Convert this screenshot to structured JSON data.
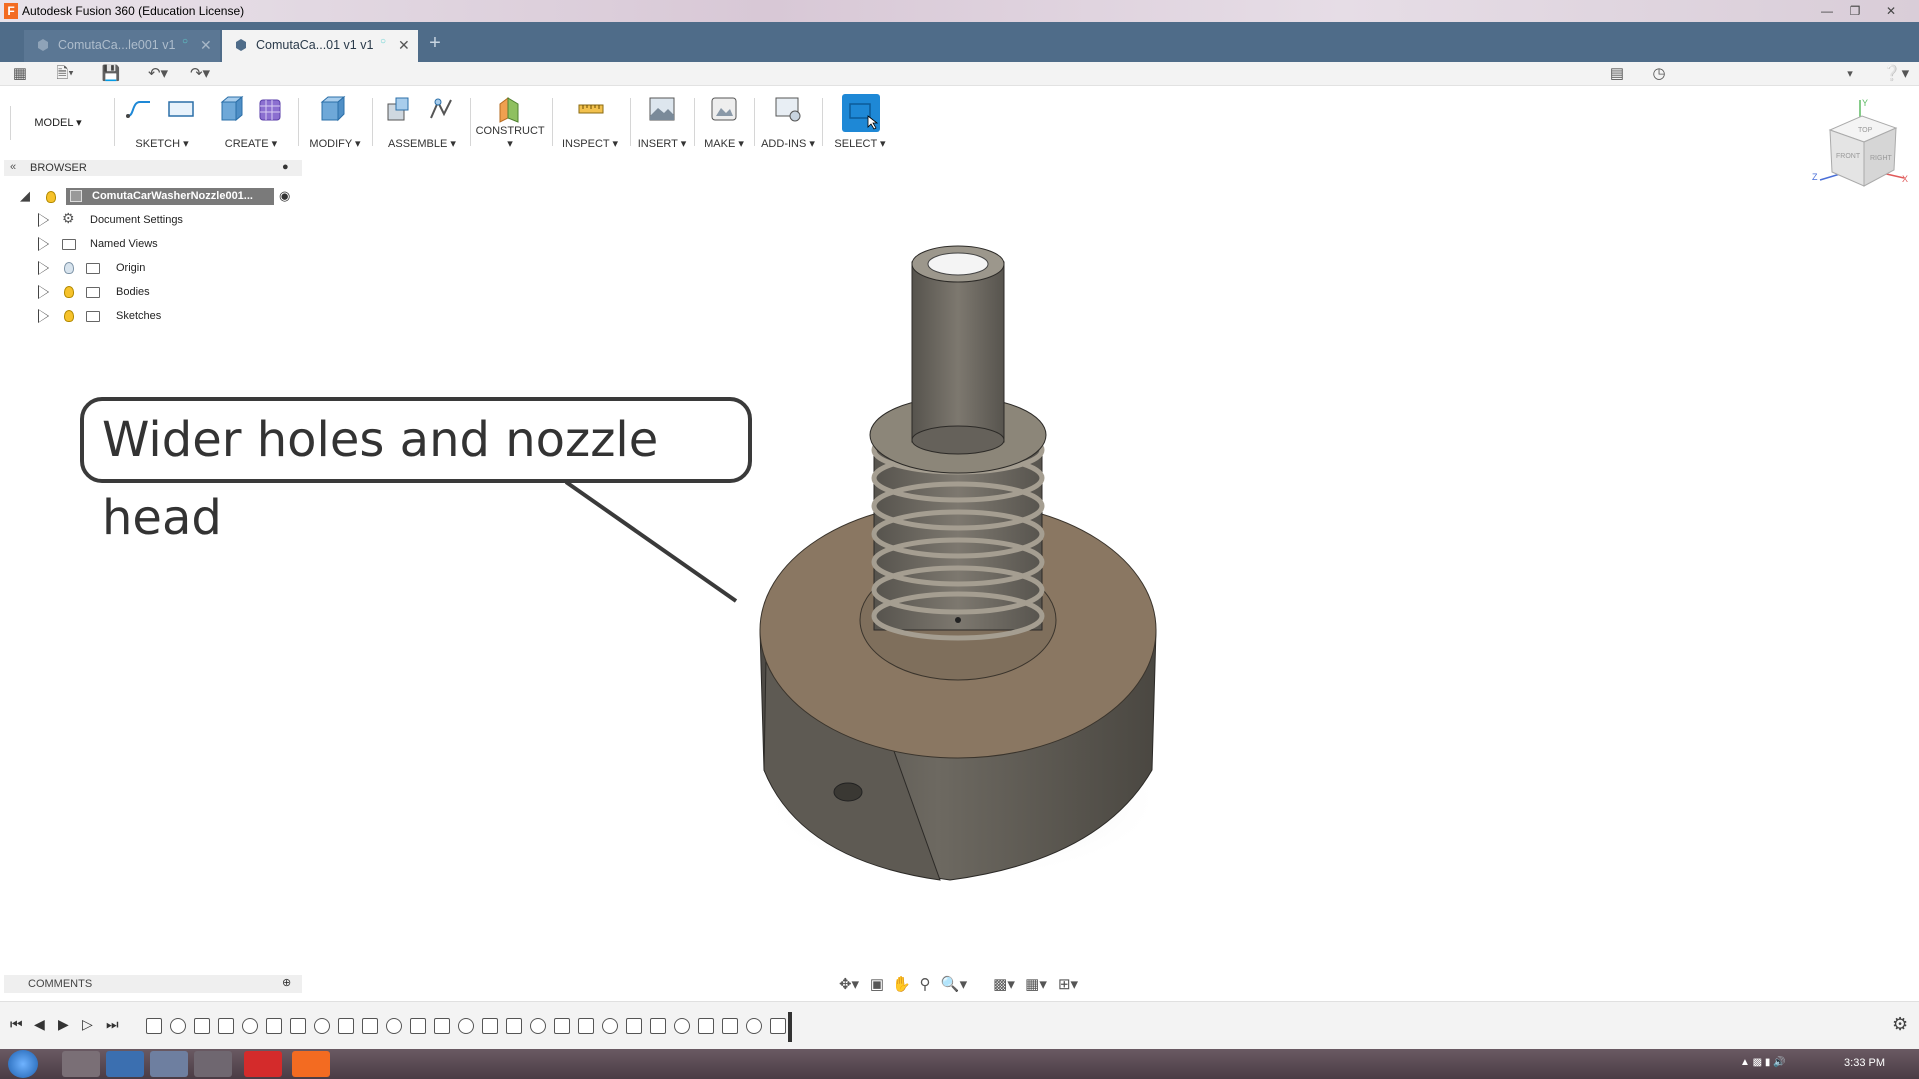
{
  "window": {
    "title": "Autodesk Fusion 360 (Education License)"
  },
  "tabs": [
    {
      "label": "ComutaCa...le001 v1",
      "active": false
    },
    {
      "label": "ComutaCa...01 v1 v1",
      "active": true
    }
  ],
  "ribbon": {
    "workspace": "MODEL",
    "groups": [
      "SKETCH",
      "CREATE",
      "MODIFY",
      "ASSEMBLE",
      "CONSTRUCT",
      "INSPECT",
      "INSERT",
      "MAKE",
      "ADD-INS",
      "SELECT"
    ]
  },
  "browser": {
    "title": "BROWSER",
    "root": "ComutaCarWasherNozzle001...",
    "items": [
      "Document Settings",
      "Named Views",
      "Origin",
      "Bodies",
      "Sketches"
    ]
  },
  "annotation": {
    "text": "Wider holes and nozzle head"
  },
  "comments": {
    "label": "COMMENTS"
  },
  "viewcube": {
    "top": "TOP",
    "front": "FRONT",
    "right": "RIGHT",
    "axis_x": "X",
    "axis_y": "Y",
    "axis_z": "Z"
  },
  "taskbar": {
    "clock": "3:33 PM"
  },
  "colors": {
    "tabbar": "#4f6c89",
    "select_active": "#1e88d6",
    "model_body": "#6b655c",
    "model_face": "#8a7762"
  },
  "icons": [
    "grid-menu-icon",
    "file-icon",
    "save-icon",
    "undo-icon",
    "redo-icon",
    "comment-icon",
    "history-icon",
    "help-icon",
    "gear-icon"
  ]
}
